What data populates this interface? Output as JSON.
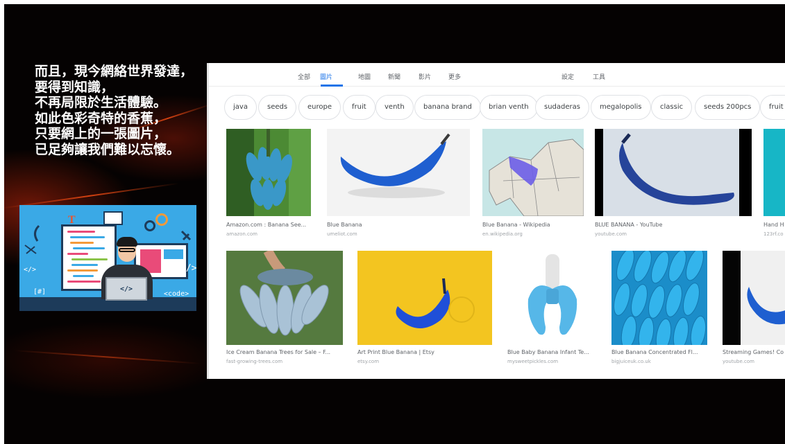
{
  "caption": {
    "lines": [
      "而且，現今網絡世界發達，",
      "要得到知識，",
      "不再局限於生活體驗。",
      "如此色彩奇特的香蕉，",
      "只要網上的一張圖片，",
      "已足夠讓我們難以忘懷。"
    ]
  },
  "illustration": {
    "laptop_text": "</>",
    "tag_left": "</>",
    "tag_right": "</>",
    "tag_hash": "[#]",
    "tag_code": "<code>"
  },
  "search_tabs": {
    "items": [
      "全部",
      "圖片",
      "地圖",
      "新聞",
      "影片",
      "更多"
    ],
    "active": "圖片",
    "settings": "設定",
    "tools": "工具"
  },
  "chips": [
    "java",
    "seeds",
    "europe",
    "fruit",
    "venth",
    "banana brand",
    "brian venth",
    "sudaderas",
    "megalopolis",
    "classic",
    "seeds 200pcs",
    "fruit m"
  ],
  "results": [
    {
      "title": "Amazon.com : Banana See...",
      "site": "amazon.com"
    },
    {
      "title": "Blue Banana",
      "site": "umeliot.com"
    },
    {
      "title": "Blue Banana - Wikipedia",
      "site": "en.wikipedia.org"
    },
    {
      "title": "BLUE BANANA - YouTube",
      "site": "youtube.com"
    },
    {
      "title": "Hand H",
      "site": "123rf.co"
    },
    {
      "title": "Ice Cream Banana Trees for Sale – F...",
      "site": "fast-growing-trees.com"
    },
    {
      "title": "Art Print Blue Banana | Etsy",
      "site": "etsy.com"
    },
    {
      "title": "Blue Baby Banana Infant Te...",
      "site": "mysweetpickles.com"
    },
    {
      "title": "Blue Banana Concentrated Fl...",
      "site": "bigjuiceuk.co.uk"
    },
    {
      "title": "Streaming Games! Co",
      "site": "youtube.com"
    }
  ],
  "colors": {
    "accent": "#1a73e8",
    "banana_blue": "#1f5fd0"
  }
}
